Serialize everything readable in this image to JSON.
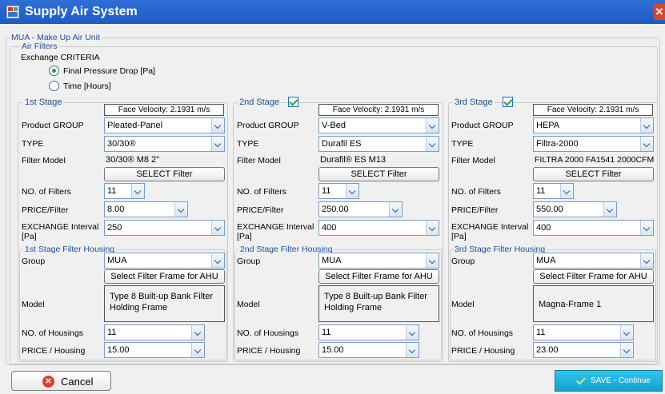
{
  "window": {
    "title": "Supply Air System",
    "close_icon": "close-icon"
  },
  "colors": {
    "titlebar": "#1e5bc4",
    "group_label": "#1a4f9c",
    "save_button": "#16a9d8",
    "check": "#2a9d3e"
  },
  "mua_label": "MUA - Make Up Air Unit",
  "air_filters_label": "Air Filters",
  "criteria": {
    "label": "Exchange CRITERIA",
    "options": [
      "Final Pressure Drop [Pa]",
      "Time [Hours]"
    ],
    "selected": "Final Pressure Drop [Pa]"
  },
  "labels": {
    "product_group": "Product GROUP",
    "type": "TYPE",
    "filter_model": "Filter Model",
    "no_filters": "NO. of Filters",
    "price_filter": "PRICE/Filter",
    "exchange_interval": "EXCHANGE Interval [Pa]",
    "group": "Group",
    "model": "Model",
    "no_housings": "NO. of Housings",
    "price_housing": "PRICE / Housing",
    "select_filter": "SELECT Filter",
    "select_frame": "Select Filter Frame for AHU"
  },
  "stages": [
    {
      "title": "1st Stage",
      "checked": null,
      "face_velocity": "Face Velocity: 2.1931 m/s",
      "product_group": "Pleated-Panel",
      "type": "30/30®",
      "filter_model": "30/30® M8 2\"",
      "no_filters": "11",
      "price_filter": "8.00",
      "exchange_interval": "250",
      "housing_title": "1st Stage Filter Housing",
      "group": "MUA",
      "model": "Type 8 Built-up Bank Filter Holding Frame",
      "no_housings": "11",
      "price_housing": "15.00"
    },
    {
      "title": "2nd Stage",
      "checked": true,
      "face_velocity": "Face Velocity: 2.1931 m/s",
      "product_group": "V-Bed",
      "type": "Durafil ES",
      "filter_model": "Durafil® ES M13",
      "no_filters": "11",
      "price_filter": "250.00",
      "exchange_interval": "400",
      "housing_title": "2nd Stage Filter Housing",
      "group": "MUA",
      "model": "Type 8 Built-up Bank Filter Holding Frame",
      "no_housings": "11",
      "price_housing": "15.00"
    },
    {
      "title": "3rd Stage",
      "checked": true,
      "face_velocity": "Face Velocity: 2.1931 m/s",
      "product_group": "HEPA",
      "type": "Filtra-2000",
      "filter_model": "FILTRA 2000 FA1541 2000CFM",
      "no_filters": "11",
      "price_filter": "550.00",
      "exchange_interval": "400",
      "housing_title": "3rd Stage Filter Housing",
      "group": "MUA",
      "model": "Magna-Frame 1",
      "no_housings": "11",
      "price_housing": "23.00"
    }
  ],
  "footer": {
    "cancel": "Cancel",
    "save": "SAVE - Continue"
  }
}
